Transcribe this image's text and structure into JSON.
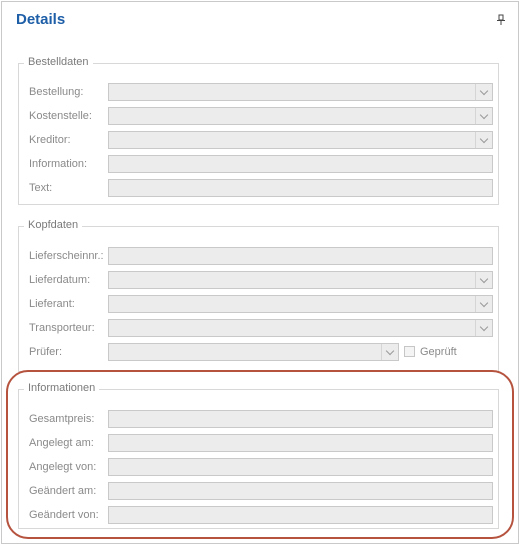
{
  "panel": {
    "title": "Details"
  },
  "sections": {
    "bestelldaten": {
      "title": "Bestelldaten",
      "fields": [
        {
          "label": "Bestellung:",
          "value": ""
        },
        {
          "label": "Kostenstelle:",
          "value": ""
        },
        {
          "label": "Kreditor:",
          "value": ""
        },
        {
          "label": "Information:",
          "value": ""
        },
        {
          "label": "Text:",
          "value": ""
        }
      ]
    },
    "kopfdaten": {
      "title": "Kopfdaten",
      "fields": [
        {
          "label": "Lieferscheinnr.:",
          "value": ""
        },
        {
          "label": "Lieferdatum:",
          "value": ""
        },
        {
          "label": "Lieferant:",
          "value": ""
        },
        {
          "label": "Transporteur:",
          "value": ""
        },
        {
          "label": "Prüfer:",
          "value": ""
        }
      ],
      "checkbox_label": "Geprüft"
    },
    "informationen": {
      "title": "Informationen",
      "fields": [
        {
          "label": "Gesamtpreis:",
          "value": ""
        },
        {
          "label": "Angelegt am:",
          "value": ""
        },
        {
          "label": "Angelegt von:",
          "value": ""
        },
        {
          "label": "Geändert am:",
          "value": ""
        },
        {
          "label": "Geändert von:",
          "value": ""
        }
      ]
    }
  },
  "highlight_color": "#b5533f"
}
